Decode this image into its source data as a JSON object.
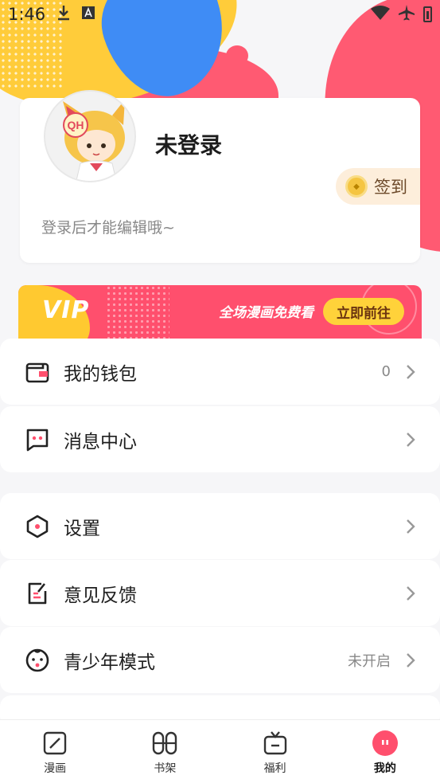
{
  "status_bar": {
    "time": "1:46"
  },
  "profile": {
    "username": "未登录",
    "hint": "登录后才能编辑哦~",
    "checkin_label": "签到",
    "avatar_badge": "QH"
  },
  "vip_banner": {
    "vip_text": "VIP",
    "slogan": "全场漫画免费看",
    "button_label": "立即前往"
  },
  "menu": {
    "items": [
      {
        "label": "我的钱包",
        "value": "0",
        "icon": "wallet-icon"
      },
      {
        "label": "消息中心",
        "value": "",
        "icon": "message-icon"
      },
      {
        "label": "设置",
        "value": "",
        "icon": "settings-icon"
      },
      {
        "label": "意见反馈",
        "value": "",
        "icon": "feedback-icon"
      },
      {
        "label": "青少年模式",
        "value": "未开启",
        "icon": "teen-mode-icon"
      }
    ]
  },
  "bottom_nav": {
    "items": [
      {
        "label": "漫画",
        "icon": "comic-icon",
        "active": false
      },
      {
        "label": "书架",
        "icon": "bookshelf-icon",
        "active": false
      },
      {
        "label": "福利",
        "icon": "welfare-icon",
        "active": false
      },
      {
        "label": "我的",
        "icon": "me-icon",
        "active": true
      }
    ]
  },
  "colors": {
    "accent": "#ff4f6d",
    "yellow": "#ffcc3a",
    "blue": "#3f8cf5",
    "background": "#f6f6f8"
  }
}
